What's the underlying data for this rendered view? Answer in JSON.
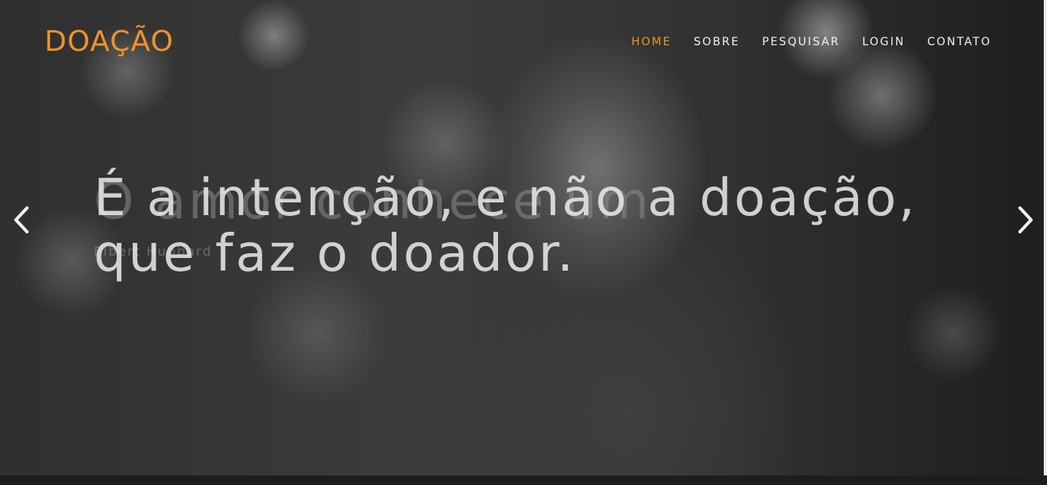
{
  "brand": {
    "name": "DOAÇÃO",
    "color": "#f0922c"
  },
  "nav": {
    "items": [
      {
        "label": "HOME",
        "active": true
      },
      {
        "label": "SOBRE",
        "active": false
      },
      {
        "label": "PESQUISAR",
        "active": false
      },
      {
        "label": "LOGIN",
        "active": false
      },
      {
        "label": "CONTATO",
        "active": false
      }
    ]
  },
  "carousel": {
    "current_slide": {
      "quote_line1": "É a intenção, e não a doação,",
      "quote_line2": "que faz o doador."
    },
    "fading_slide": {
      "quote": "O amor conhece um",
      "author": "Elbert Hubbard"
    },
    "prev_icon": "chevron-left-icon",
    "next_icon": "chevron-right-icon"
  }
}
